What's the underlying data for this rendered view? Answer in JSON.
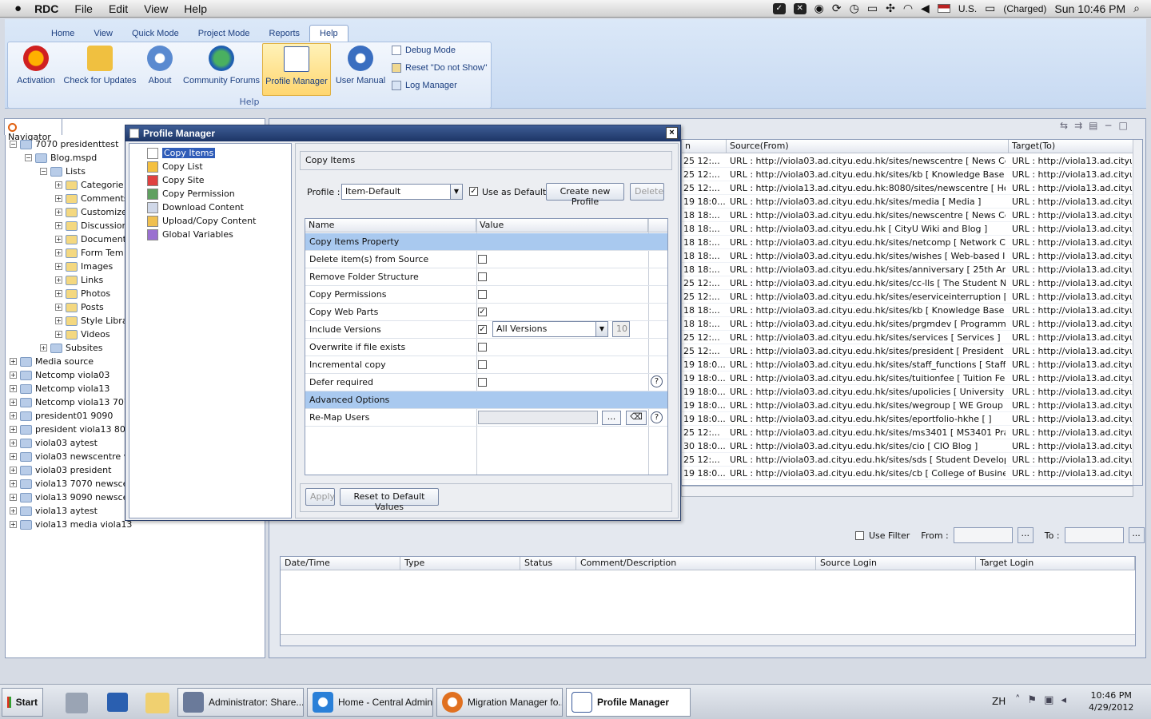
{
  "menubar": {
    "app": "RDC",
    "items": [
      "File",
      "Edit",
      "View",
      "Help"
    ],
    "battery": "(Charged)",
    "input_source": "U.S.",
    "clock": "Sun 10:46 PM"
  },
  "ribbon": {
    "tabs": [
      "Home",
      "View",
      "Quick Mode",
      "Project Mode",
      "Reports",
      "Help"
    ],
    "active_tab": "Help",
    "buttons": [
      "Activation",
      "Check for Updates",
      "About",
      "Community Forums",
      "Profile Manager",
      "User Manual"
    ],
    "small_buttons": [
      "Debug Mode",
      "Reset \"Do not Show\"",
      "Log Manager"
    ],
    "group_label": "Help"
  },
  "navigator": {
    "tab": "Navigator",
    "items": [
      {
        "label": "7070 presidenttest",
        "level": 0
      },
      {
        "label": "Blog.mspd",
        "level": 1
      },
      {
        "label": "Lists",
        "level": 2
      },
      {
        "label": "Categorie",
        "level": 3
      },
      {
        "label": "Comments",
        "level": 3
      },
      {
        "label": "Customize",
        "level": 3
      },
      {
        "label": "Discussion",
        "level": 3
      },
      {
        "label": "Document",
        "level": 3
      },
      {
        "label": "Form Tem",
        "level": 3
      },
      {
        "label": "Images",
        "level": 3
      },
      {
        "label": "Links",
        "level": 3
      },
      {
        "label": "Photos",
        "level": 3
      },
      {
        "label": "Posts",
        "level": 3
      },
      {
        "label": "Style Libra",
        "level": 3
      },
      {
        "label": "Videos",
        "level": 3
      },
      {
        "label": "Subsites",
        "level": 2
      },
      {
        "label": "Media source",
        "level": 0
      },
      {
        "label": "Netcomp viola03",
        "level": 0
      },
      {
        "label": "Netcomp viola13",
        "level": 0
      },
      {
        "label": "Netcomp viola13 7070",
        "level": 0
      },
      {
        "label": "president01 9090",
        "level": 0
      },
      {
        "label": "president viola13 808",
        "level": 0
      },
      {
        "label": "viola03 aytest",
        "level": 0
      },
      {
        "label": "viola03 newscentre vi",
        "level": 0
      },
      {
        "label": "viola03 president",
        "level": 0
      },
      {
        "label": "viola13 7070 newscer",
        "level": 0
      },
      {
        "label": "viola13 9090 newscer",
        "level": 0
      },
      {
        "label": "viola13 aytest",
        "level": 0
      },
      {
        "label": "viola13 media viola13",
        "level": 0
      }
    ]
  },
  "grid": {
    "headers": [
      "n",
      "Source(From)",
      "Target(To)"
    ],
    "rows": [
      [
        "25 12:...",
        "URL : http://viola03.ad.cityu.edu.hk/sites/newscentre [ News Centre ]",
        "URL : http://viola13.ad.cityu.ed"
      ],
      [
        "25 12:...",
        "URL : http://viola03.ad.cityu.edu.hk/sites/kb [ Knowledge Base ]",
        "URL : http://viola13.ad.cityu.ed"
      ],
      [
        "25 12:...",
        "URL : http://viola13.ad.cityu.edu.hk:8080/sites/newscentre [ Home ]",
        "URL : http://viola13.ad.cityu.ed"
      ],
      [
        "19 18:0...",
        "URL : http://viola03.ad.cityu.edu.hk/sites/media [ Media ]",
        "URL : http://viola13.ad.cityu.ed"
      ],
      [
        "18 18:...",
        "URL : http://viola03.ad.cityu.edu.hk/sites/newscentre [ News Centre ]",
        "URL : http://viola13.ad.cityu.ed"
      ],
      [
        "18 18:...",
        "URL : http://viola03.ad.cityu.edu.hk [ CityU Wiki and Blog ]",
        "URL : http://viola13.ad.cityu.ed"
      ],
      [
        "18 18:...",
        "URL : http://viola03.ad.cityu.edu.hk/sites/netcomp [ Network Compu...",
        "URL : http://viola13.ad.cityu.ed"
      ],
      [
        "18 18:...",
        "URL : http://viola03.ad.cityu.edu.hk/sites/wishes [ Web-based Integ...",
        "URL : http://viola13.ad.cityu.ed"
      ],
      [
        "18 18:...",
        "URL : http://viola03.ad.cityu.edu.hk/sites/anniversary [ 25th Annive...",
        "URL : http://viola13.ad.cityu.ed"
      ],
      [
        "25 12:...",
        "URL : http://viola03.ad.cityu.edu.hk/sites/cc-lls [ The Student Noteb...",
        "URL : http://viola13.ad.cityu.ed"
      ],
      [
        "25 12:...",
        "URL : http://viola03.ad.cityu.edu.hk/sites/eserviceinterruption [ Serv...",
        "URL : http://viola13.ad.cityu.ed"
      ],
      [
        "18 18:...",
        "URL : http://viola03.ad.cityu.edu.hk/sites/kb [ Knowledge Base ]",
        "URL : http://viola13.ad.cityu.ed"
      ],
      [
        "18 18:...",
        "URL : http://viola03.ad.cityu.edu.hk/sites/prgmdev [ Programmes an...",
        "URL : http://viola13.ad.cityu.ed"
      ],
      [
        "25 12:...",
        "URL : http://viola03.ad.cityu.edu.hk/sites/services [ Services ]",
        "URL : http://viola13.ad.cityu.ed"
      ],
      [
        "25 12:...",
        "URL : http://viola03.ad.cityu.edu.hk/sites/president [ President ]",
        "URL : http://viola13.ad.cityu.ed"
      ],
      [
        "19 18:0...",
        "URL : http://viola03.ad.cityu.edu.hk/sites/staff_functions [ Staff Fun...",
        "URL : http://viola13.ad.cityu.ed"
      ],
      [
        "19 18:0...",
        "URL : http://viola03.ad.cityu.edu.hk/sites/tuitionfee [ Tuition Fee ]",
        "URL : http://viola13.ad.cityu.ed"
      ],
      [
        "19 18:0...",
        "URL : http://viola03.ad.cityu.edu.hk/sites/upolicies [ University Polici...",
        "URL : http://viola13.ad.cityu.ed"
      ],
      [
        "19 18:0...",
        "URL : http://viola03.ad.cityu.edu.hk/sites/wegroup [ WE Group ]",
        "URL : http://viola13.ad.cityu.ed"
      ],
      [
        "19 18:0...",
        "URL : http://viola03.ad.cityu.edu.hk/sites/eportfolio-hkhe [ ]",
        "URL : http://viola13.ad.cityu.ed"
      ],
      [
        "25 12:...",
        "URL : http://viola03.ad.cityu.edu.hk/sites/ms3401 [ MS3401 Practical...",
        "URL : http://viola13.ad.cityu.ed"
      ],
      [
        "30 18:0...",
        "URL : http://viola03.ad.cityu.edu.hk/sites/cio [ CIO Blog ]",
        "URL : http://viola13.ad.cityu.ed"
      ],
      [
        "25 12:...",
        "URL : http://viola03.ad.cityu.edu.hk/sites/sds [ Student Developmen...",
        "URL : http://viola13.ad.cityu.ed"
      ],
      [
        "19 18:0...",
        "URL : http://viola03.ad.cityu.edu.hk/sites/cb [ College of Business ]",
        "URL : http://viola13.ad.cityu.ed"
      ]
    ]
  },
  "log": {
    "use_filter": "Use Filter",
    "from": "From :",
    "to": "To :",
    "ellipsis": "...",
    "headers": [
      "Date/Time",
      "Type",
      "Status",
      "Comment/Description",
      "Source Login",
      "Target Login"
    ]
  },
  "dialog": {
    "title": "Profile Manager",
    "close": "×",
    "tree": [
      "Copy Items",
      "Copy List",
      "Copy Site",
      "Copy Permission",
      "Download Content",
      "Upload/Copy Content",
      "Global Variables"
    ],
    "selected": "Copy Items",
    "header": "Copy Items",
    "profile_label": "Profile :",
    "profile_value": "Item-Default",
    "use_default": "Use as Default",
    "create_btn": "Create new Profile",
    "delete_btn": "Delete",
    "col_name": "Name",
    "col_value": "Value",
    "section1": "Copy Items Property",
    "props": [
      {
        "name": "Delete item(s) from Source",
        "checked": false
      },
      {
        "name": "Remove Folder Structure",
        "checked": false
      },
      {
        "name": "Copy Permissions",
        "checked": false
      },
      {
        "name": "Copy Web Parts",
        "checked": true
      },
      {
        "name": "Include Versions",
        "checked": true
      },
      {
        "name": "Overwrite if file exists",
        "checked": false
      },
      {
        "name": "Incremental copy",
        "checked": false
      },
      {
        "name": "Defer required",
        "checked": false
      }
    ],
    "versions_value": "All Versions",
    "versions_count": "10",
    "section2": "Advanced Options",
    "remap": "Re-Map Users",
    "remap_btn": "...",
    "help": "?",
    "apply_btn": "Apply",
    "reset_btn": "Reset to Default Values"
  },
  "taskbar": {
    "start": "Start",
    "tasks": [
      "Administrator: Share...",
      "Home - Central Admin...",
      "Migration Manager fo...",
      "Profile Manager"
    ],
    "lang": "ZH",
    "time": "10:46 PM",
    "date": "4/29/2012"
  }
}
